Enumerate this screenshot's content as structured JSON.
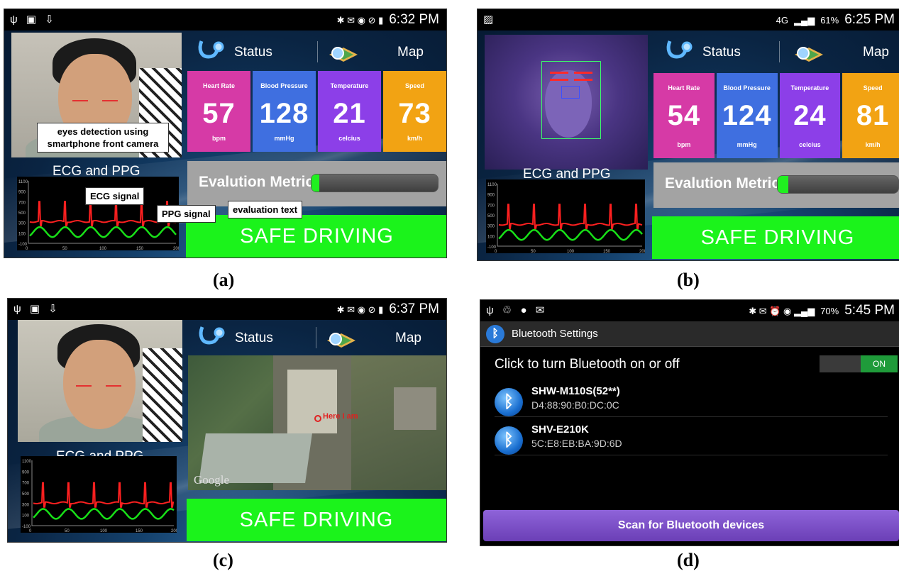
{
  "captions": {
    "a": "(a)",
    "b": "(b)",
    "c": "(c)",
    "d": "(d)"
  },
  "colors": {
    "heart_rate": "#d63aa6",
    "blood_pressure": "#3f6fe0",
    "temperature": "#8c3fe8",
    "speed": "#f2a313",
    "safe": "#1bf31b",
    "ecg": "#ff2020",
    "ppg": "#18e018",
    "scan_button": "#7a4cc8"
  },
  "panel_a": {
    "status_bar": {
      "left_icons": "usb-icon sd-icon download-icon",
      "time": "6:32 PM"
    },
    "tabs": {
      "status": "Status",
      "map": "Map"
    },
    "tiles": [
      {
        "title": "Heart Rate",
        "value": "57",
        "unit": "bpm"
      },
      {
        "title": "Blood Pressure",
        "value": "128",
        "unit": "mmHg"
      },
      {
        "title": "Temperature",
        "value": "21",
        "unit": "celcius"
      },
      {
        "title": "Speed",
        "value": "73",
        "unit": "km/h"
      }
    ],
    "metrics_label": "Evalution Metrics",
    "metrics_level": 0.06,
    "evaluation_text": "SAFE DRIVING",
    "ecg_title": "ECG and PPG",
    "annotations": {
      "eyes": "eyes detection using smartphone  front camera",
      "ecg": "ECG signal",
      "ppg": "PPG signal",
      "evaluation": "evaluation text"
    }
  },
  "panel_b": {
    "status_bar": {
      "network": "4G",
      "battery": "61%",
      "time": "6:25 PM"
    },
    "tabs": {
      "status": "Status",
      "map": "Map"
    },
    "tiles": [
      {
        "title": "Heart Rate",
        "value": "54",
        "unit": "bpm"
      },
      {
        "title": "Blood Pressure",
        "value": "124",
        "unit": "mmHg"
      },
      {
        "title": "Temperature",
        "value": "24",
        "unit": "celcius"
      },
      {
        "title": "Speed",
        "value": "81",
        "unit": "km/h"
      }
    ],
    "metrics_label": "Evalution Metrics",
    "metrics_level": 0.09,
    "evaluation_text": "SAFE DRIVING",
    "ecg_title": "ECG and PPG"
  },
  "panel_c": {
    "status_bar": {
      "time": "6:37 PM"
    },
    "tabs": {
      "status": "Status",
      "map": "Map"
    },
    "map_marker": "Here I am",
    "map_watermark": "Google",
    "evaluation_text": "SAFE DRIVING",
    "ecg_title": "ECG and PPG"
  },
  "panel_d": {
    "status_bar": {
      "battery": "70%",
      "time": "5:45 PM"
    },
    "title": "Bluetooth Settings",
    "toggle_prompt": "Click to turn Bluetooth on or off",
    "toggle_state": "ON",
    "devices": [
      {
        "name": "SHW-M110S(52**)",
        "address": "D4:88:90:B0:DC:0C"
      },
      {
        "name": "SHV-E210K",
        "address": "5C:E8:EB:BA:9D:6D"
      }
    ],
    "scan_button": "Scan for Bluetooth devices"
  },
  "ecg_axes": {
    "y_ticks": [
      "1100",
      "900",
      "700",
      "500",
      "300",
      "100",
      "-100"
    ],
    "x_ticks": [
      "0",
      "50",
      "100",
      "150",
      "200"
    ]
  }
}
